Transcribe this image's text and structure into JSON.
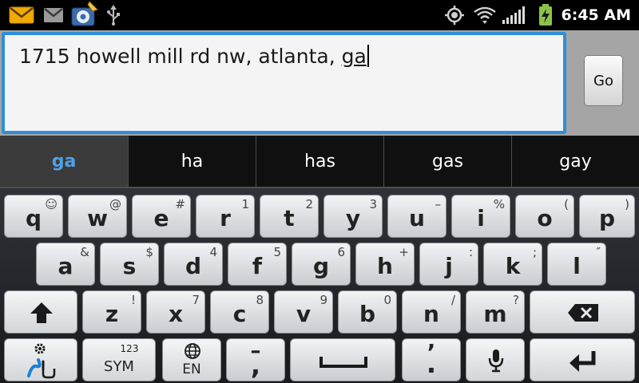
{
  "status_bar": {
    "time": "6:45 AM",
    "left_icons": [
      "email-icon",
      "gmail-icon",
      "app-notification-icon",
      "usb-icon"
    ],
    "right_icons": [
      "gps-icon",
      "wifi-icon",
      "signal-icon",
      "battery-charging-icon"
    ]
  },
  "input": {
    "committed_text": "1715 howell mill rd nw, atlanta, ",
    "composing_text": "ga",
    "go_label": "Go"
  },
  "suggestions": [
    "ga",
    "ha",
    "has",
    "gas",
    "gay"
  ],
  "keyboard": {
    "row1": [
      {
        "main": "q",
        "sub": "☺"
      },
      {
        "main": "w",
        "sub": "@"
      },
      {
        "main": "e",
        "sub": "#"
      },
      {
        "main": "r",
        "sub": "1"
      },
      {
        "main": "t",
        "sub": "2"
      },
      {
        "main": "y",
        "sub": "3"
      },
      {
        "main": "u",
        "sub": "–"
      },
      {
        "main": "i",
        "sub": "%"
      },
      {
        "main": "o",
        "sub": "("
      },
      {
        "main": "p",
        "sub": ")"
      }
    ],
    "row2": [
      {
        "main": "a",
        "sub": "&"
      },
      {
        "main": "s",
        "sub": "$"
      },
      {
        "main": "d",
        "sub": "4"
      },
      {
        "main": "f",
        "sub": "5"
      },
      {
        "main": "g",
        "sub": "6"
      },
      {
        "main": "h",
        "sub": "+"
      },
      {
        "main": "j",
        "sub": ":"
      },
      {
        "main": "k",
        "sub": ";"
      },
      {
        "main": "l",
        "sub": "″"
      }
    ],
    "row3": [
      {
        "main": "z",
        "sub": "!"
      },
      {
        "main": "x",
        "sub": "7"
      },
      {
        "main": "c",
        "sub": "8"
      },
      {
        "main": "v",
        "sub": "9"
      },
      {
        "main": "b",
        "sub": "0"
      },
      {
        "main": "n",
        "sub": "/"
      },
      {
        "main": "m",
        "sub": "?"
      }
    ],
    "sym_label": "SYM",
    "sym_sub": "123",
    "lang_label": "EN",
    "comma_key": ",",
    "comma_sub": "–",
    "period_key": ".",
    "period_sub": "’"
  },
  "colors": {
    "accent": "#2e8fd8",
    "suggestion_active": "#4fa0e6",
    "battery": "#8bc34a"
  }
}
